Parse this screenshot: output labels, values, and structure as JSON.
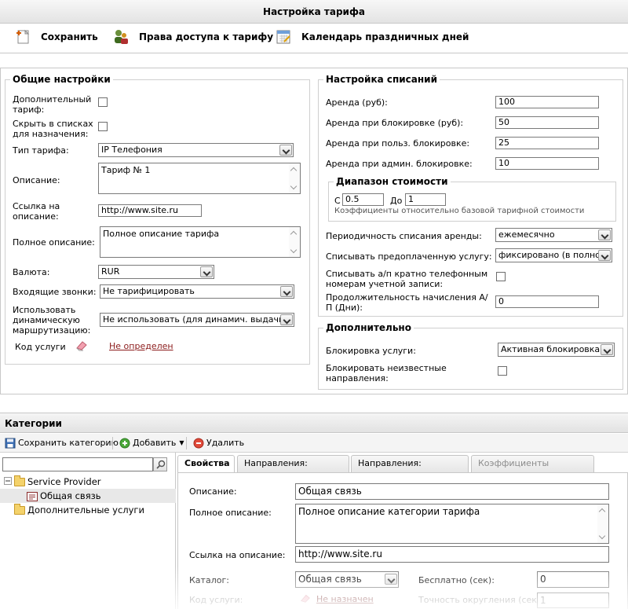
{
  "header": {
    "title": "Настройка тарифа",
    "toolbar": {
      "save": "Сохранить",
      "access": "Права доступа к тарифу",
      "calendar": "Календарь праздничных дней"
    }
  },
  "general": {
    "legend": "Общие настройки",
    "additional_tariff_label": "Дополнительный тариф:",
    "hide_in_lists_label": "Скрыть в списках для назначения:",
    "tariff_type_label": "Тип тарифа:",
    "tariff_type_value": "IP Телефония",
    "description_label": "Описание:",
    "description_value": "Тариф № 1",
    "desc_link_label": "Ссылка на описание:",
    "desc_link_value": "http://www.site.ru",
    "full_desc_label": "Полное описание:",
    "full_desc_value": "Полное описание тарифа",
    "currency_label": "Валюта:",
    "currency_value": "RUR",
    "incoming_label": "Входящие звонки:",
    "incoming_value": "Не тарифицировать",
    "dyn_routing_label": "Использовать динамическую маршрутизацию:",
    "dyn_routing_value": "Не использовать (для динамич. выдачи",
    "service_code_label": "Код услуги",
    "service_code_link": "Не определен"
  },
  "charges": {
    "legend": "Настройка списаний",
    "rent_label": "Аренда (руб):",
    "rent_value": "100",
    "rent_block_label": "Аренда при блокировке (руб):",
    "rent_block_value": "50",
    "rent_user_block_label": "Аренда при польз. блокировке:",
    "rent_user_block_value": "25",
    "rent_admin_block_label": "Аренда при админ. блокировке:",
    "rent_admin_block_value": "10",
    "range_legend": "Диапазон стоимости",
    "range_from_label": "С",
    "range_from_value": "0.5",
    "range_to_label": "До",
    "range_to_value": "1",
    "range_hint": "Коэффициенты относительно базовой тарифной стоимости",
    "periodicity_label": "Периодичность списания аренды:",
    "periodicity_value": "ежемесячно",
    "prepaid_label": "Списывать предоплаченную услугу:",
    "prepaid_value": "фиксировано (в полном",
    "multiple_label": "Списывать а/п кратно телефонным номерам учетной записи:",
    "duration_label": "Продолжительность начисления А/П (Дни):",
    "duration_value": "0"
  },
  "extra": {
    "legend": "Дополнительно",
    "block_service_label": "Блокировка услуги:",
    "block_service_value": "Активная блокировка",
    "block_unknown_label": "Блокировать неизвестные направления:"
  },
  "categories": {
    "title": "Категории",
    "toolbar": {
      "save": "Сохранить категорию",
      "add": "Добавить",
      "delete": "Удалить"
    },
    "tree": {
      "root": "Service Provider",
      "child": "Общая связь",
      "other": "Дополнительные услуги"
    },
    "tabs": {
      "props": "Свойства",
      "incoming": "Направления: Входящие",
      "outgoing": "Направления: Исходящие",
      "coefs": "Коэффициенты маршрутов"
    },
    "props": {
      "desc_label": "Описание:",
      "desc_value": "Общая связь",
      "full_desc_label": "Полное описание:",
      "full_desc_value": "Полное описание категории тарифа",
      "link_label": "Ссылка на описание:",
      "link_value": "http://www.site.ru",
      "catalog_label": "Каталог:",
      "catalog_value": "Общая связь",
      "free_label": "Бесплатно (сек):",
      "free_value": "0",
      "code_label": "Код услуги:",
      "code_link": "Не назначен",
      "rounding_label": "Точность округления (сек):",
      "rounding_value": "1"
    }
  }
}
